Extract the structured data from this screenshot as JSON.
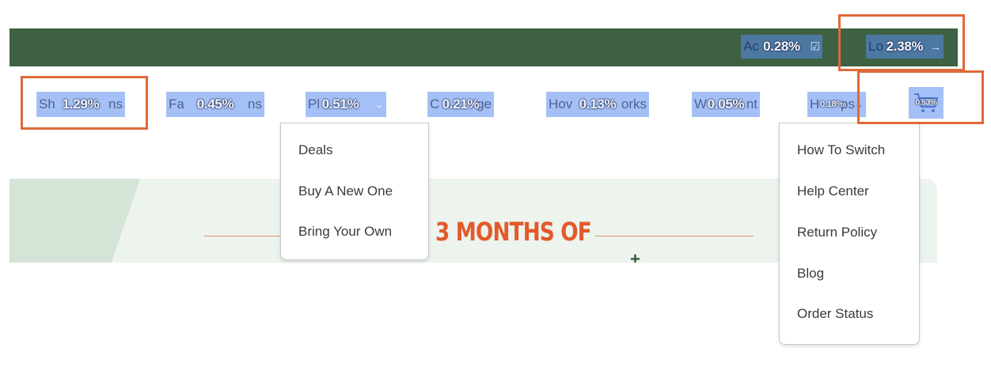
{
  "topbar": {
    "account": {
      "label_partial": "Ac",
      "overlay": "0.28%",
      "icon": "account-box-icon"
    },
    "login": {
      "label_partial": "Lo",
      "overlay": "2.38%",
      "icon": "login-arrow-icon"
    }
  },
  "nav": {
    "shop_plans": {
      "left": "Sh",
      "right": "ns",
      "overlay": "1.29%"
    },
    "family_plans": {
      "left": "Fa",
      "right": "ns",
      "overlay": "0.45%"
    },
    "phones": {
      "left": "Pl",
      "overlay": "0.51%"
    },
    "coverage": {
      "left": "C",
      "right": "ge",
      "overlay": "0.21%"
    },
    "how_it_works": {
      "left": "Hov",
      "right": "orks",
      "overlay": "0.13%"
    },
    "why": {
      "left": "W",
      "right": "nt",
      "overlay": "0.05%"
    },
    "help": {
      "left": "H",
      "right": "ps",
      "overlay": "0.18%"
    },
    "cart": {
      "overlay": "0.53%",
      "icon": "cart-icon"
    }
  },
  "phones_menu": {
    "items": [
      "Deals",
      "Buy A New One",
      "Bring Your Own"
    ]
  },
  "help_menu": {
    "items": [
      "How To Switch",
      "Help Center",
      "Return Policy",
      "Blog",
      "Order Status"
    ]
  },
  "hero": {
    "headline": "3 MONTHS OF",
    "plus": "+"
  },
  "colors": {
    "topbar": "#3d6142",
    "highlight": "#5a8cf0",
    "selection": "#e06a3a",
    "headline": "#e35a2a"
  }
}
